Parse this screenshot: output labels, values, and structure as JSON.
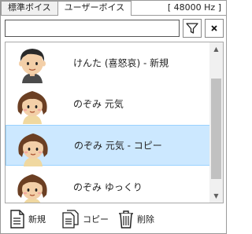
{
  "tabs": [
    {
      "label": "標準ボイス",
      "active": false
    },
    {
      "label": "ユーザーボイス",
      "active": true
    }
  ],
  "sample_rate": "[ 48000 Hz ]",
  "search": {
    "value": "",
    "placeholder": ""
  },
  "icons": {
    "filter": "filter-icon",
    "clear": "close-icon",
    "new": "new-document-icon",
    "copy": "copy-document-icon",
    "delete": "trash-icon"
  },
  "voices": [
    {
      "label": "けんた (喜怒哀) - 新規",
      "avatar": "boy",
      "selected": false
    },
    {
      "label": "のぞみ 元気",
      "avatar": "girl",
      "selected": false
    },
    {
      "label": "のぞみ 元気 - コピー",
      "avatar": "girl",
      "selected": true
    },
    {
      "label": "のぞみ ゆっくり",
      "avatar": "girl",
      "selected": false
    }
  ],
  "toolbar": {
    "new_label": "新規",
    "copy_label": "コピー",
    "delete_label": "削除"
  },
  "colors": {
    "selection": "#cce8ff",
    "selection_border": "#99d1ff"
  }
}
